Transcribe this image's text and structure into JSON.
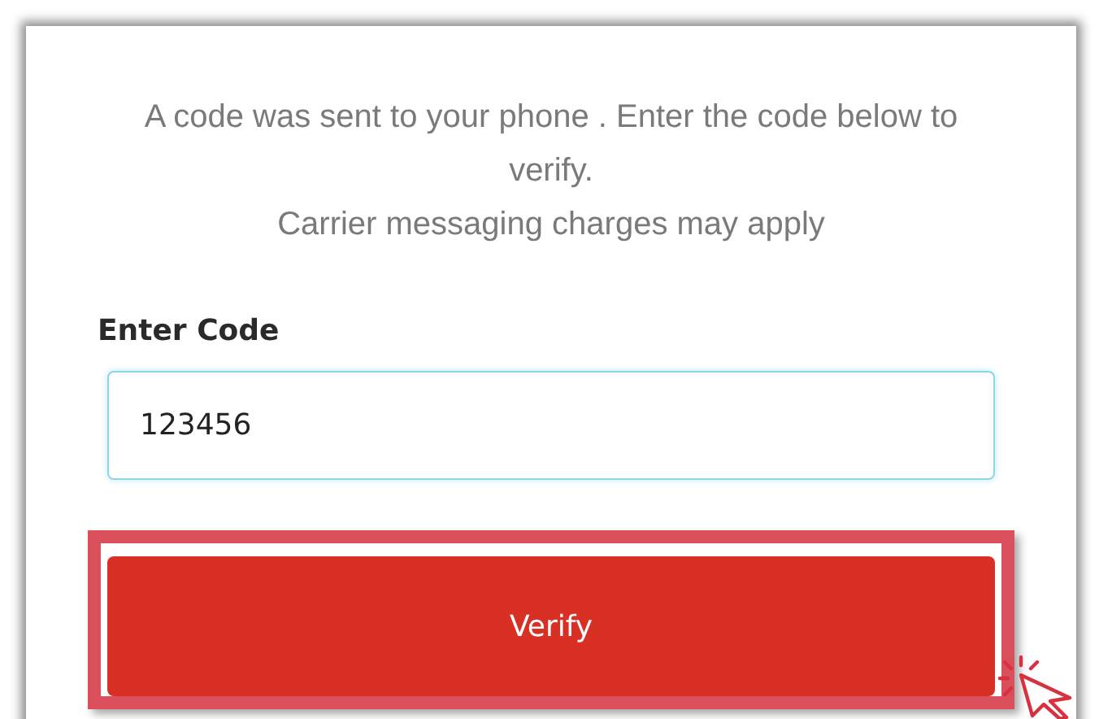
{
  "message": "A code was sent to your phone .  Enter the code below to verify.",
  "note": "Carrier messaging charges may apply",
  "code_field": {
    "label": "Enter Code",
    "value": "123456"
  },
  "verify_button": {
    "label": "Verify",
    "highlighted": true
  }
}
